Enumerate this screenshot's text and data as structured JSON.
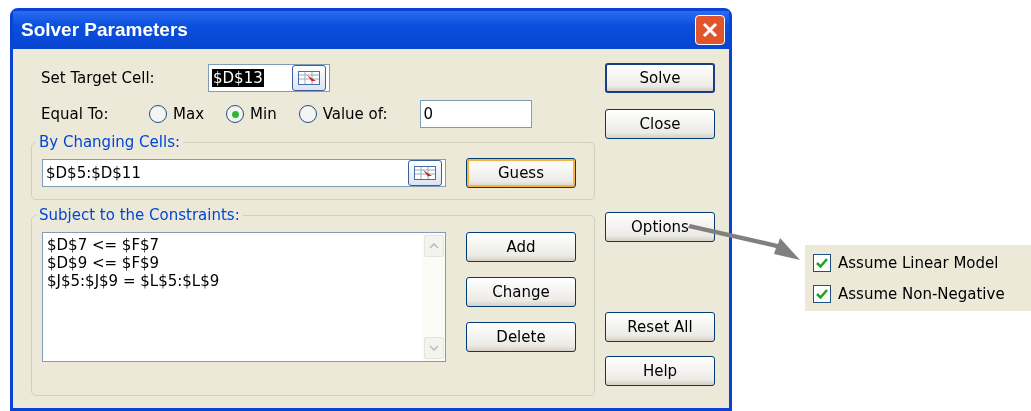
{
  "window": {
    "title": "Solver Parameters"
  },
  "target_cell": {
    "label": "Set Target Cell:",
    "value": "$D$13",
    "selected": true
  },
  "equal_to": {
    "label": "Equal To:",
    "value": "0",
    "options": [
      {
        "label": "Max",
        "selected": false
      },
      {
        "label": "Min",
        "selected": true
      },
      {
        "label": "Value of:",
        "selected": false
      }
    ]
  },
  "changing_cells": {
    "label": "By Changing Cells:",
    "value": "$D$5:$D$11",
    "button": {
      "label": "Guess",
      "hot": true
    }
  },
  "constraints": {
    "label": "Subject to the Constraints:",
    "items": [
      "$D$7 <= $F$7",
      "$D$9 <= $F$9",
      "$J$5:$J$9 = $L$5:$L$9"
    ],
    "buttons": [
      {
        "label": "Add"
      },
      {
        "label": "Change"
      },
      {
        "label": "Delete"
      }
    ]
  },
  "side_buttons": [
    {
      "label": "Solve",
      "default": true
    },
    {
      "label": "Close",
      "default": false
    },
    {
      "label": "Options",
      "default": false
    },
    {
      "label": "Reset All",
      "default": false
    },
    {
      "label": "Help",
      "default": false
    }
  ],
  "options_panel": {
    "items": [
      {
        "label": "Assume Linear Model",
        "checked": true
      },
      {
        "label": "Assume Non-Negative",
        "checked": true
      }
    ]
  }
}
